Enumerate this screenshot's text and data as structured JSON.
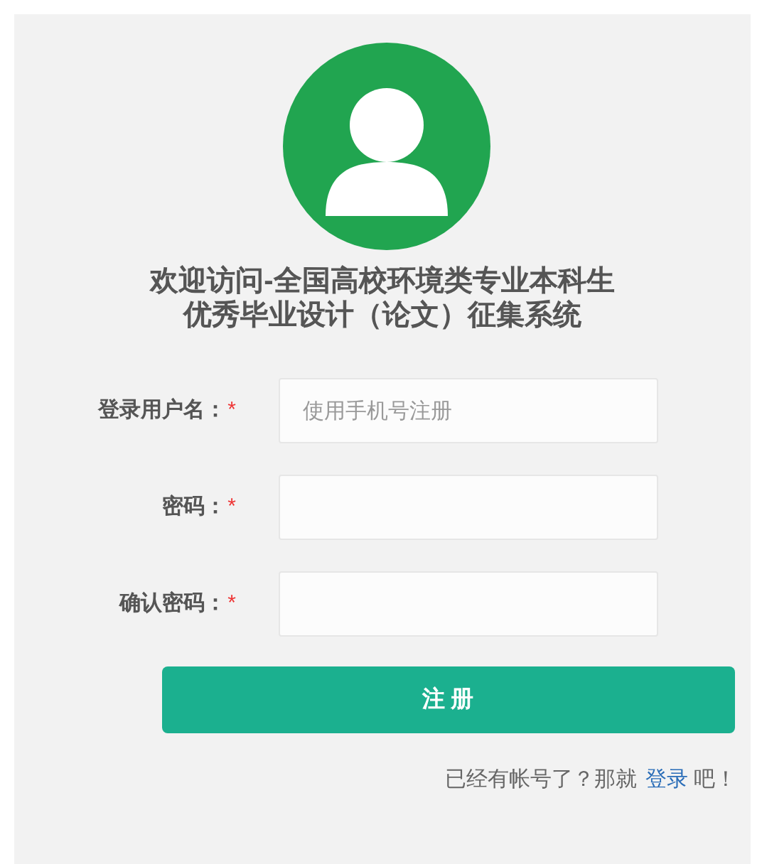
{
  "title_lines": [
    "欢迎访问-全国高校环境类专业本科生",
    "优秀毕业设计（论文）征集系统"
  ],
  "fields": [
    {
      "label": "登录用户名：",
      "required_mark": "*",
      "placeholder": "使用手机号注册"
    },
    {
      "label": "密码：",
      "required_mark": "*"
    },
    {
      "label": "确认密码：",
      "required_mark": "*"
    }
  ],
  "submit_button": "注 册",
  "footer": {
    "before": "已经有帐号了？那就",
    "link": "登录",
    "after": "吧！"
  }
}
